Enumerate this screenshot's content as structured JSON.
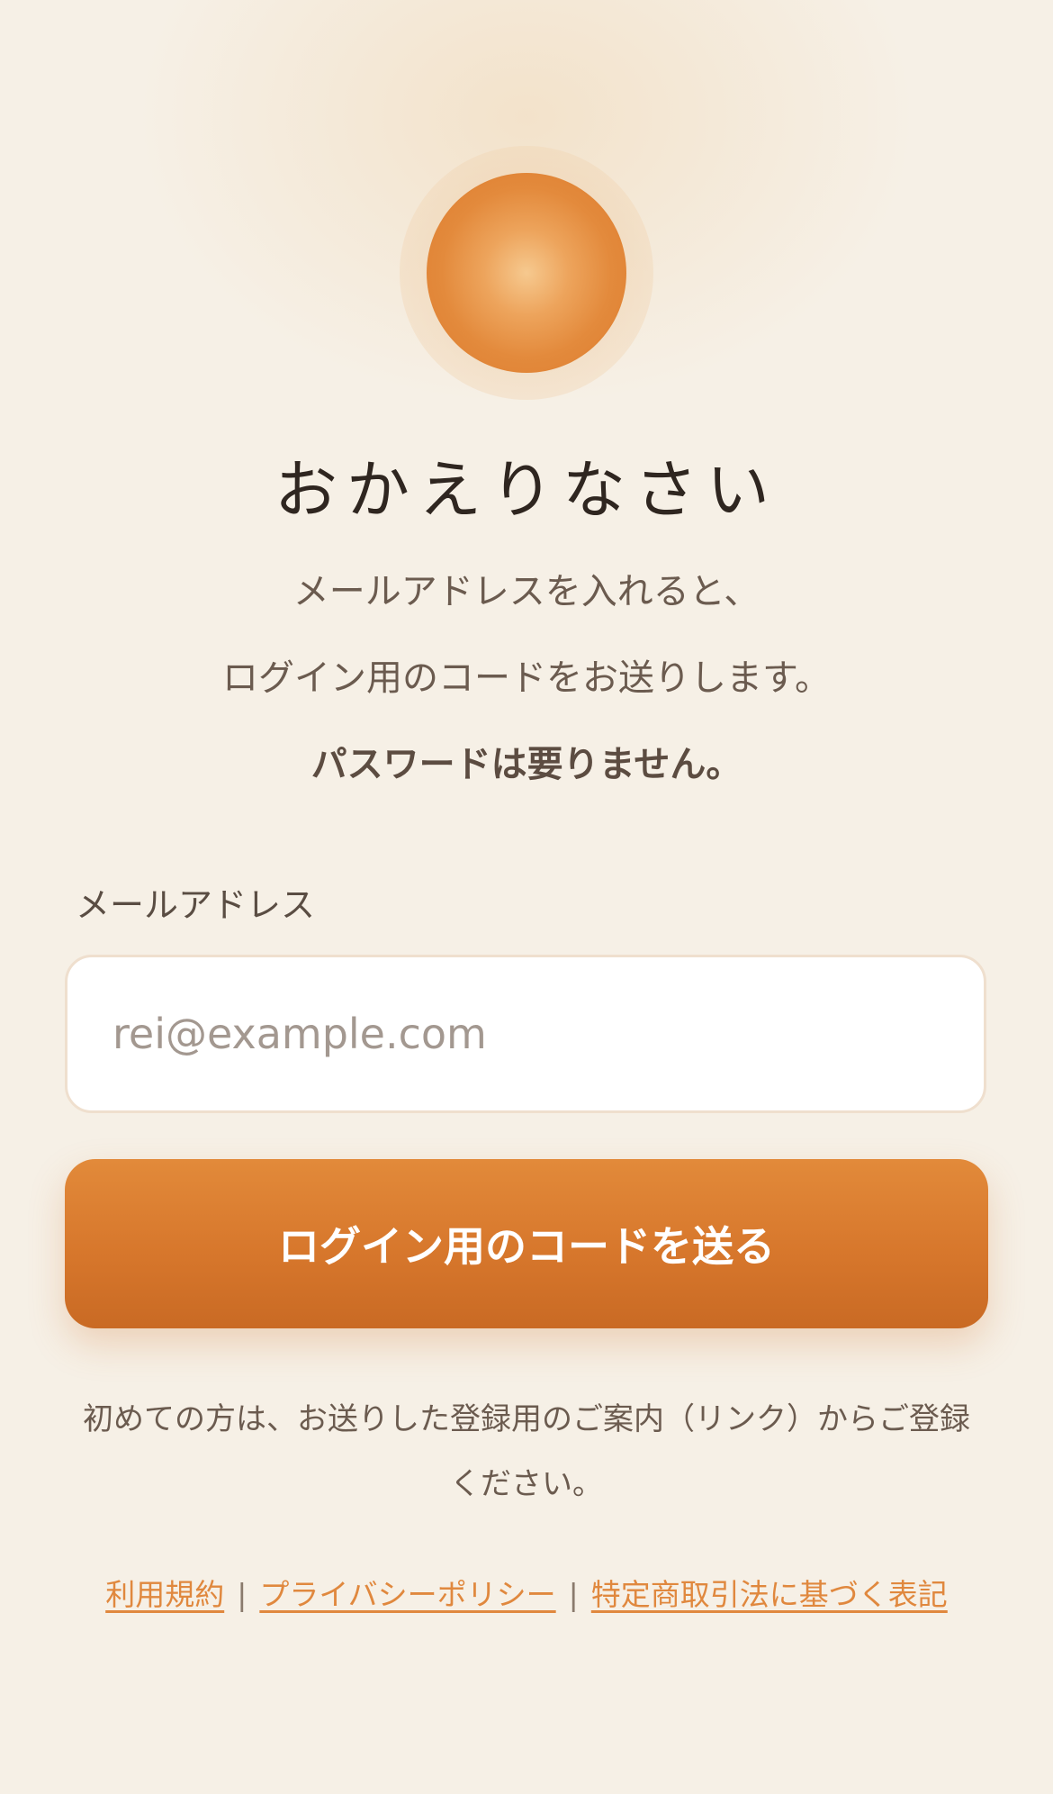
{
  "header": {
    "title": "おかえりなさい",
    "subtitle_line1": "メールアドレスを入れると、",
    "subtitle_line2": "ログイン用のコードをお送りします。",
    "subtitle_line3": "パスワードは要りません。"
  },
  "form": {
    "email_label": "メールアドレス",
    "email_placeholder": "rei@example.com",
    "email_value": "",
    "submit_label": "ログイン用のコードを送る"
  },
  "note": "初めての方は、お送りした登録用のご案内（リンク）からご登録ください。",
  "footer": {
    "links": [
      {
        "label": "利用規約"
      },
      {
        "label": "プライバシーポリシー"
      },
      {
        "label": "特定商取引法に基づく表記"
      }
    ],
    "separator": "|"
  },
  "colors": {
    "background": "#f6f0e6",
    "accent": "#e0883e",
    "button": "#d7772c"
  },
  "icons": {
    "logo": "sun-orb-logo-icon"
  }
}
